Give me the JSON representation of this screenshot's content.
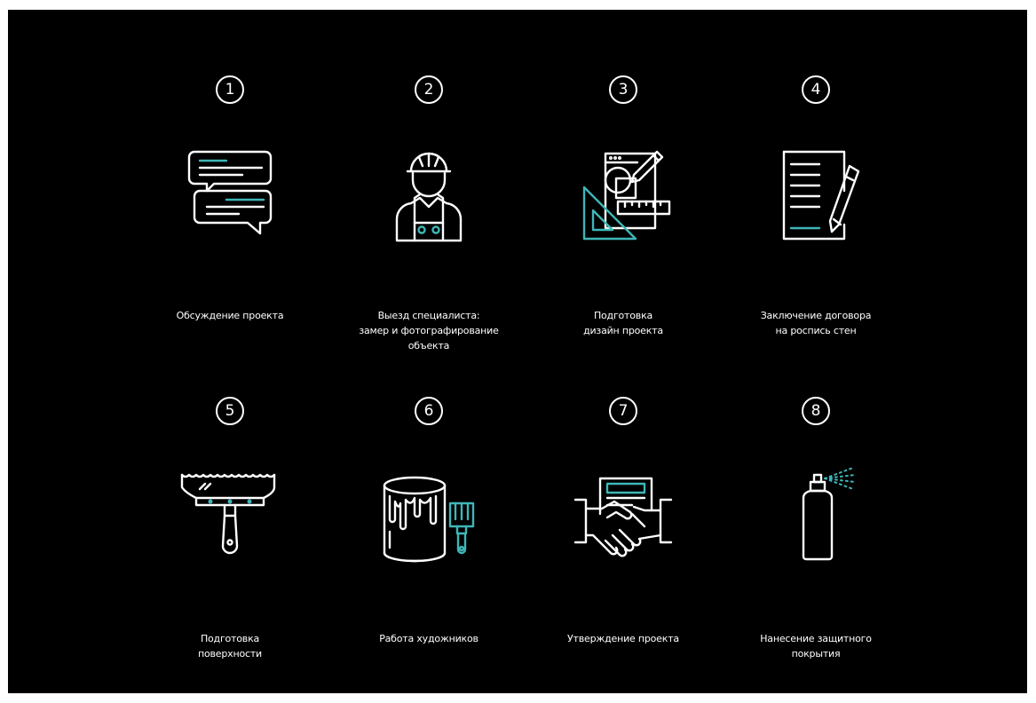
{
  "colors": {
    "background": "#000000",
    "line": "#ffffff",
    "accent": "#3fb6b8"
  },
  "steps": [
    {
      "number": "1",
      "icon": "chat-bubbles-icon",
      "label_lines": [
        "Обсуждение проекта"
      ]
    },
    {
      "number": "2",
      "icon": "worker-helmet-icon",
      "label_lines": [
        "Выезд специалиста:",
        "замер и фотографирование",
        "объекта"
      ]
    },
    {
      "number": "3",
      "icon": "design-tools-icon",
      "label_lines": [
        "Подготовка",
        "дизайн проекта"
      ]
    },
    {
      "number": "4",
      "icon": "contract-pencil-icon",
      "label_lines": [
        "Заключение договора",
        "на роспись стен"
      ]
    },
    {
      "number": "5",
      "icon": "spatula-icon",
      "label_lines": [
        "Подготовка",
        "поверхности"
      ]
    },
    {
      "number": "6",
      "icon": "paint-bucket-brush-icon",
      "label_lines": [
        "Работа художников"
      ]
    },
    {
      "number": "7",
      "icon": "handshake-document-icon",
      "label_lines": [
        "Утверждение проекта"
      ]
    },
    {
      "number": "8",
      "icon": "spray-can-icon",
      "label_lines": [
        "Нанесение защитного",
        "покрытия"
      ]
    }
  ]
}
